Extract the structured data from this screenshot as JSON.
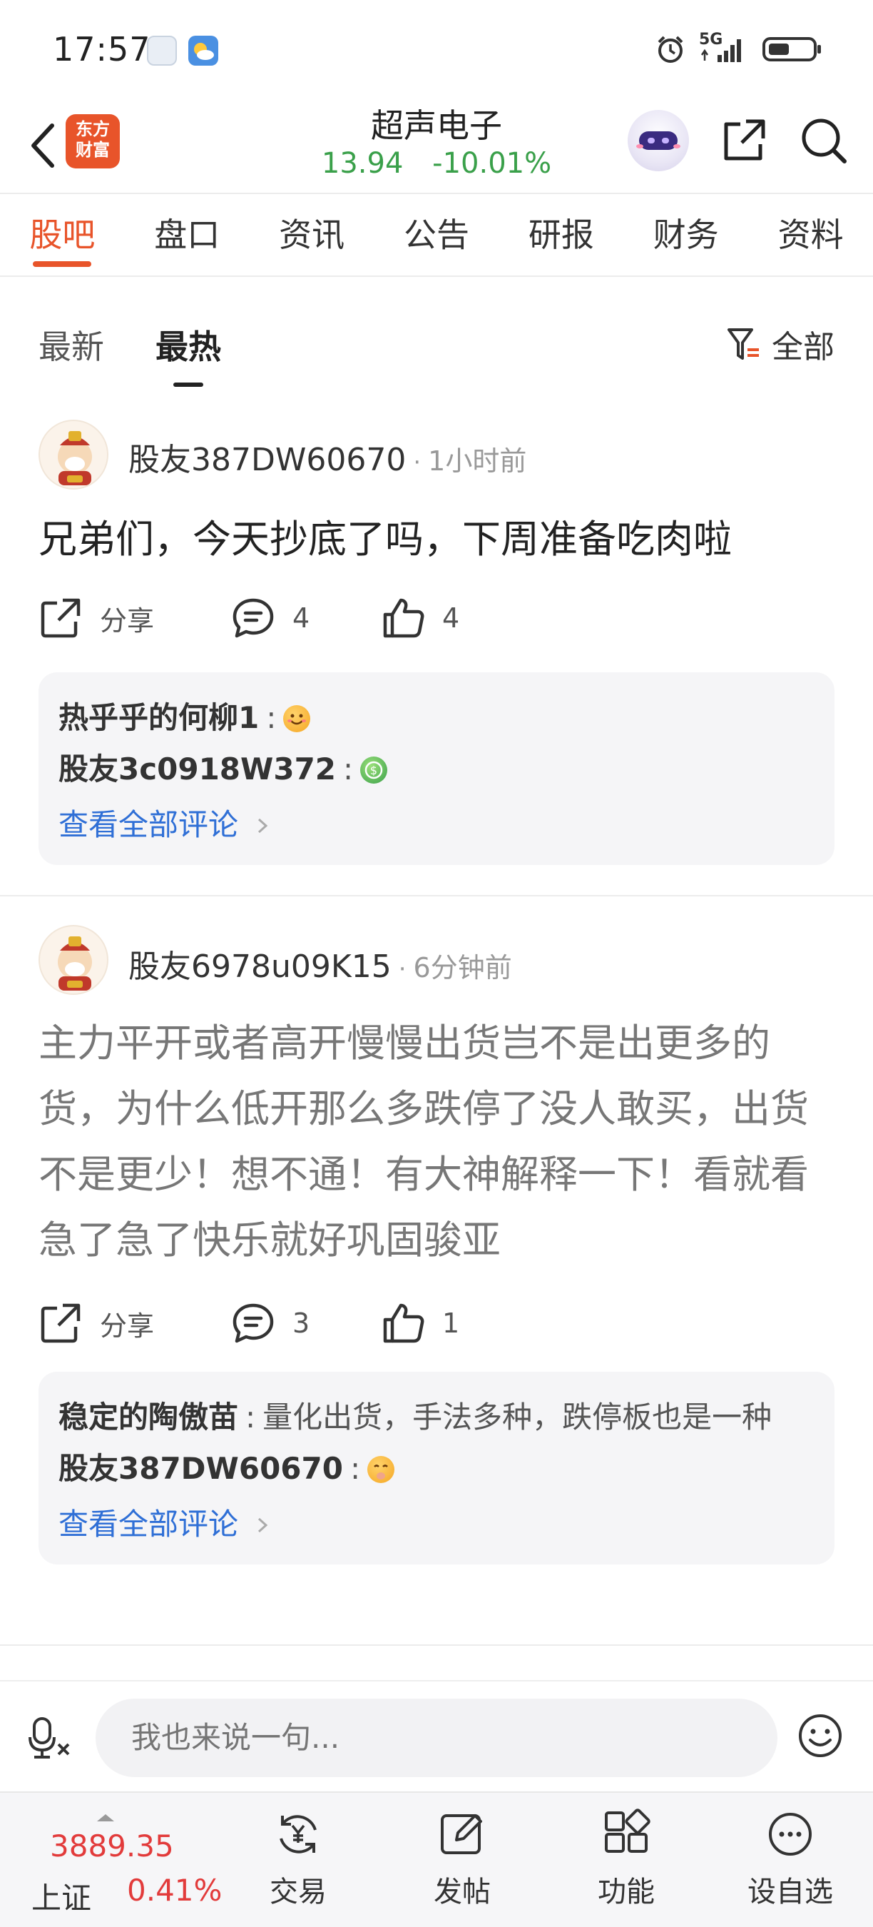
{
  "status_bar": {
    "time": "17:57",
    "network": "5G"
  },
  "header": {
    "logo_text": "东方\n财富",
    "stock_name": "超声电子",
    "price": "13.94",
    "change_pct": "-10.01%"
  },
  "tabs": [
    {
      "label": "股吧",
      "active": true
    },
    {
      "label": "盘口"
    },
    {
      "label": "资讯"
    },
    {
      "label": "公告"
    },
    {
      "label": "研报"
    },
    {
      "label": "财务"
    },
    {
      "label": "资料"
    }
  ],
  "sort": {
    "latest": "最新",
    "hottest": "最热",
    "filter_label": "全部"
  },
  "posts": [
    {
      "author": "股友387DW60670",
      "time": "1小时前",
      "body": "兄弟们，今天抄底了吗，下周准备吃肉啦",
      "share_label": "分享",
      "comments": "4",
      "likes": "4",
      "replies": [
        {
          "name": "热乎乎的何柳1",
          "text": "",
          "emoji": "smile-emoji-icon"
        },
        {
          "name": "股友3c0918W372",
          "text": "",
          "emoji": "coin-emoji-icon"
        }
      ],
      "view_all": "查看全部评论"
    },
    {
      "author": "股友6978u09K15",
      "time": "6分钟前",
      "body": "主力平开或者高开慢慢出货岂不是出更多的货，为什么低开那么多跌停了没人敢买，出货不是更少！想不通！有大神解释一下！看就看急了急了快乐就好巩固骏亚",
      "share_label": "分享",
      "comments": "3",
      "likes": "1",
      "replies": [
        {
          "name": "稳定的陶傲苗",
          "text": "量化出货，手法多种，跌停板也是一种",
          "emoji": ""
        },
        {
          "name": "股友387DW60670",
          "text": "",
          "emoji": "shush-emoji-icon"
        }
      ],
      "view_all": "查看全部评论"
    }
  ],
  "input": {
    "placeholder": "我也来说一句..."
  },
  "bottom_nav": {
    "index_value": "3889.35",
    "index_name": "上证",
    "index_change": "0.41%",
    "items": [
      {
        "label": "交易",
        "icon": "yen-refresh-icon"
      },
      {
        "label": "发帖",
        "icon": "edit-icon"
      },
      {
        "label": "功能",
        "icon": "grid-icon"
      },
      {
        "label": "设自选",
        "icon": "more-dots-icon"
      }
    ]
  },
  "colors": {
    "accent": "#e8542a",
    "down_green": "#3aa04a",
    "up_red": "#e23b3b",
    "link_blue": "#2f6fd6"
  }
}
